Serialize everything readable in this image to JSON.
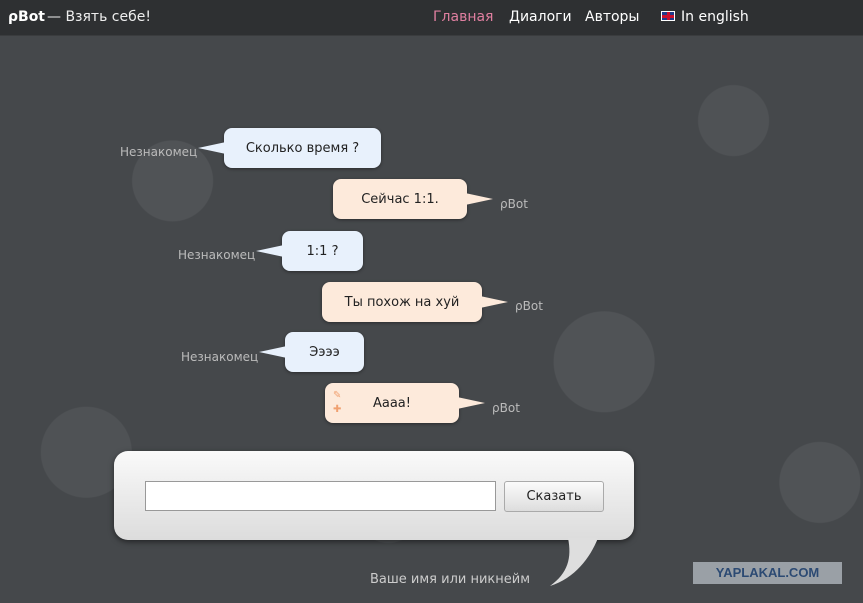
{
  "header": {
    "brand": "ρBot",
    "tagline": "— Взять себе!",
    "nav": [
      "Главная",
      "Диалоги",
      "Авторы"
    ],
    "lang": "In english"
  },
  "messages": [
    {
      "who": "Незнакомец",
      "text": "Сколько время ?",
      "from": "user"
    },
    {
      "who": "ρBot",
      "text": "Сейчас 1:1.",
      "from": "bot"
    },
    {
      "who": "Незнакомец",
      "text": "1:1 ?",
      "from": "user"
    },
    {
      "who": "ρBot",
      "text": "Ты похож на хуй",
      "from": "bot"
    },
    {
      "who": "Незнакомец",
      "text": "Ээээ",
      "from": "user"
    },
    {
      "who": "ρBot",
      "text": "Аааа!",
      "from": "bot"
    }
  ],
  "form": {
    "input_value": "",
    "button": "Сказать",
    "name_hint": "Ваше имя или никнейм"
  },
  "watermark": "YAPLAKAL.COM"
}
